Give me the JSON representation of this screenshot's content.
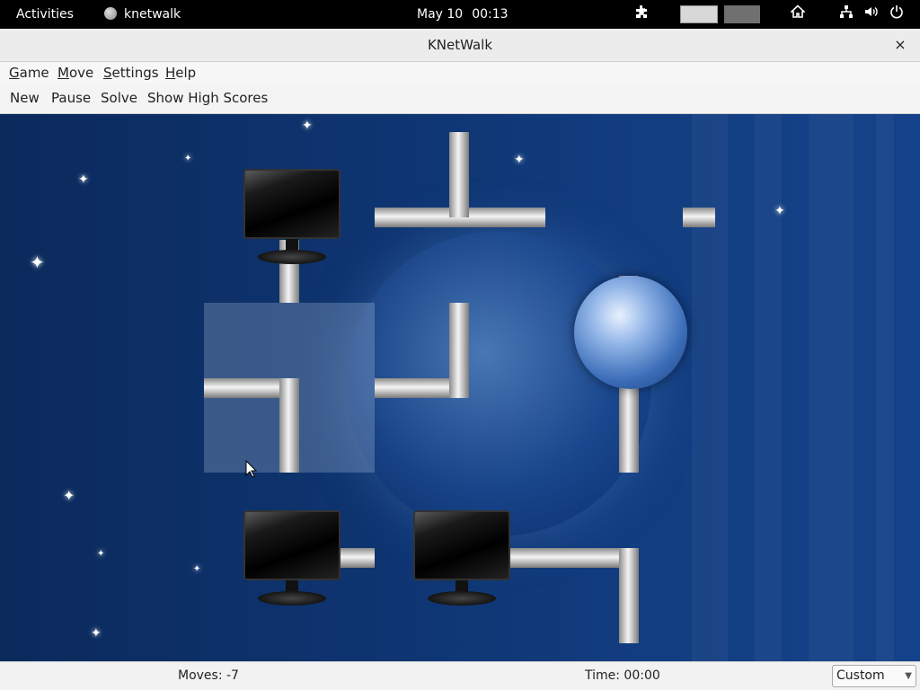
{
  "topbar": {
    "activities": "Activities",
    "app_name": "knetwalk",
    "date": "May 10",
    "time": "00:13",
    "icons": [
      "extensions-icon",
      "workspace-1",
      "workspace-2",
      "home-icon",
      "network-icon",
      "volume-icon",
      "power-icon"
    ]
  },
  "window": {
    "title": "KNetWalk",
    "close_glyph": "×"
  },
  "menubar": {
    "items": [
      {
        "label": "Game",
        "mnemonic": "G"
      },
      {
        "label": "Move",
        "mnemonic": "M"
      },
      {
        "label": "Settings",
        "mnemonic": "S"
      },
      {
        "label": "Help",
        "mnemonic": "H"
      }
    ]
  },
  "toolbar": {
    "new": "New",
    "pause": "Pause",
    "solve": "Solve",
    "high_scores": "Show High Scores"
  },
  "board": {
    "theme_colors": {
      "background": "#0e3470",
      "pipe": "#d9d9d9"
    },
    "tiles": [
      {
        "row": 0,
        "col": 0,
        "content": "computer"
      },
      {
        "row": 0,
        "col": 1,
        "content": "pipe-tee"
      },
      {
        "row": 0,
        "col": 2,
        "content": "server"
      },
      {
        "row": 1,
        "col": 0,
        "content": "pipe-corner",
        "selected": true
      },
      {
        "row": 1,
        "col": 1,
        "content": "pipe-corner"
      },
      {
        "row": 1,
        "col": 2,
        "content": "pipe-straight"
      },
      {
        "row": 2,
        "col": 0,
        "content": "computer"
      },
      {
        "row": 2,
        "col": 1,
        "content": "computer"
      },
      {
        "row": 2,
        "col": 2,
        "content": "pipe-corner"
      }
    ]
  },
  "status": {
    "moves": "Moves: -7",
    "time": "Time: 00:00",
    "difficulty": "Custom"
  }
}
